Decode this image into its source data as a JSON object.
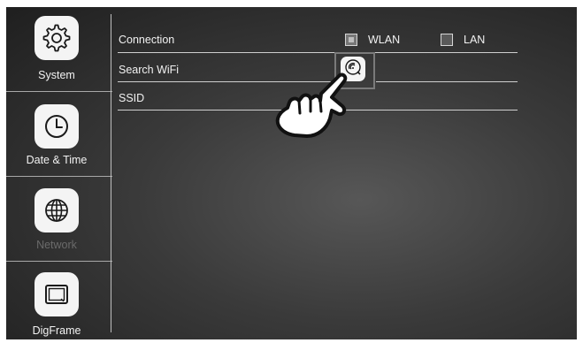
{
  "sidebar": {
    "items": [
      {
        "label": "System",
        "icon": "gear-icon",
        "enabled": true
      },
      {
        "label": "Date & Time",
        "icon": "clock-icon",
        "enabled": true
      },
      {
        "label": "Network",
        "icon": "globe-icon",
        "enabled": false
      },
      {
        "label": "DigFrame",
        "icon": "picture-frame-icon",
        "enabled": true
      }
    ]
  },
  "main": {
    "connection": {
      "label": "Connection",
      "options": [
        {
          "label": "WLAN",
          "checked": true
        },
        {
          "label": "LAN",
          "checked": false
        }
      ]
    },
    "search_wifi": {
      "label": "Search WiFi",
      "button_icon": "wifi-scan-icon"
    },
    "ssid": {
      "label": "SSID",
      "value": ""
    }
  },
  "overlay": {
    "pointer": "hand-pointer-icon"
  },
  "colors": {
    "background_center": "#575757",
    "background_edge": "#1f1f1f",
    "tile": "#f4f4f4",
    "text": "#f2f2f2",
    "disabled_text": "#6a6a6a"
  }
}
